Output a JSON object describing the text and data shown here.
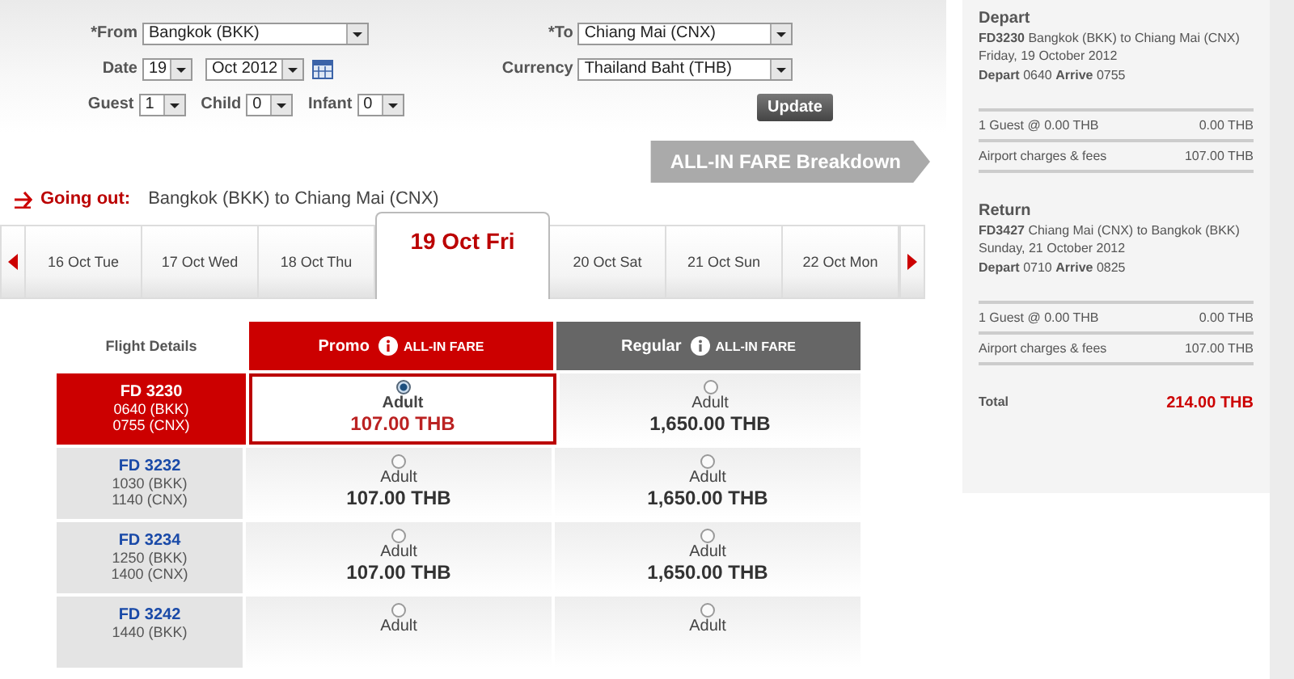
{
  "search_form": {
    "from": {
      "label": "*From",
      "value": "Bangkok (BKK)"
    },
    "to": {
      "label": "*To",
      "value": "Chiang Mai (CNX)"
    },
    "date": {
      "label": "Date",
      "day": "19",
      "month": "Oct 2012"
    },
    "currency": {
      "label": "Currency",
      "value": "Thailand Baht (THB)"
    },
    "passengers": [
      {
        "label": "Guest",
        "value": "1"
      },
      {
        "label": "Child",
        "value": "0"
      },
      {
        "label": "Infant",
        "value": "0"
      }
    ],
    "update_button": "Update"
  },
  "breakdown_banner": "ALL-IN FARE Breakdown",
  "going_out": {
    "label": "Going out:",
    "route": "Bangkok (BKK)  to  Chiang Mai (CNX)"
  },
  "date_tabs": [
    {
      "label": "16 Oct Tue",
      "selected": false
    },
    {
      "label": "17 Oct Wed",
      "selected": false
    },
    {
      "label": "18 Oct Thu",
      "selected": false
    },
    {
      "label": "19 Oct Fri",
      "selected": true
    },
    {
      "label": "20 Oct Sat",
      "selected": false
    },
    {
      "label": "21 Oct Sun",
      "selected": false
    },
    {
      "label": "22 Oct Mon",
      "selected": false
    }
  ],
  "fare_table": {
    "details_heading": "Flight Details",
    "columns": [
      {
        "name": "Promo",
        "tag": "ALL-IN FARE",
        "kind": "promo"
      },
      {
        "name": "Regular",
        "tag": "ALL-IN FARE",
        "kind": "regular"
      }
    ],
    "rows": [
      {
        "flight": "FD  3230",
        "depart": "0640  (BKK)",
        "arrive": "0755  (CNX)",
        "selected": true,
        "fares": [
          {
            "type": "Adult",
            "price": "107.00 THB",
            "selected": true
          },
          {
            "type": "Adult",
            "price": "1,650.00 THB",
            "selected": false
          }
        ]
      },
      {
        "flight": "FD  3232",
        "depart": "1030  (BKK)",
        "arrive": "1140  (CNX)",
        "selected": false,
        "fares": [
          {
            "type": "Adult",
            "price": "107.00 THB",
            "selected": false
          },
          {
            "type": "Adult",
            "price": "1,650.00 THB",
            "selected": false
          }
        ]
      },
      {
        "flight": "FD  3234",
        "depart": "1250  (BKK)",
        "arrive": "1400  (CNX)",
        "selected": false,
        "fares": [
          {
            "type": "Adult",
            "price": "107.00 THB",
            "selected": false
          },
          {
            "type": "Adult",
            "price": "1,650.00 THB",
            "selected": false
          }
        ]
      },
      {
        "flight": "FD  3242",
        "depart": "1440  (BKK)",
        "selected": false,
        "fares": [
          {
            "type": "Adult",
            "selected": false
          },
          {
            "type": "Adult",
            "selected": false
          }
        ]
      }
    ]
  },
  "summary": {
    "legs": [
      {
        "heading": "Depart",
        "flight": "**FD3230** Bangkok (BKK) to Chiang Mai (CNX)",
        "date": "Friday, 19 October 2012",
        "times": "**Depart** 0640 **Arrive** 0755",
        "lines": [
          {
            "label": "1 Guest @ 0.00 THB",
            "amount": "0.00 THB"
          },
          {
            "label": "Airport charges & fees",
            "amount": "107.00 THB"
          }
        ]
      },
      {
        "heading": "Return",
        "flight": "**FD3427** Chiang Mai (CNX) to Bangkok (BKK)",
        "date": "Sunday, 21 October 2012",
        "times": "**Depart** 0710 **Arrive** 0825",
        "lines": [
          {
            "label": "1 Guest @ 0.00 THB",
            "amount": "0.00 THB"
          },
          {
            "label": "Airport charges & fees",
            "amount": "107.00 THB"
          }
        ]
      }
    ],
    "total_label": "Total",
    "total": "214.00 THB"
  }
}
